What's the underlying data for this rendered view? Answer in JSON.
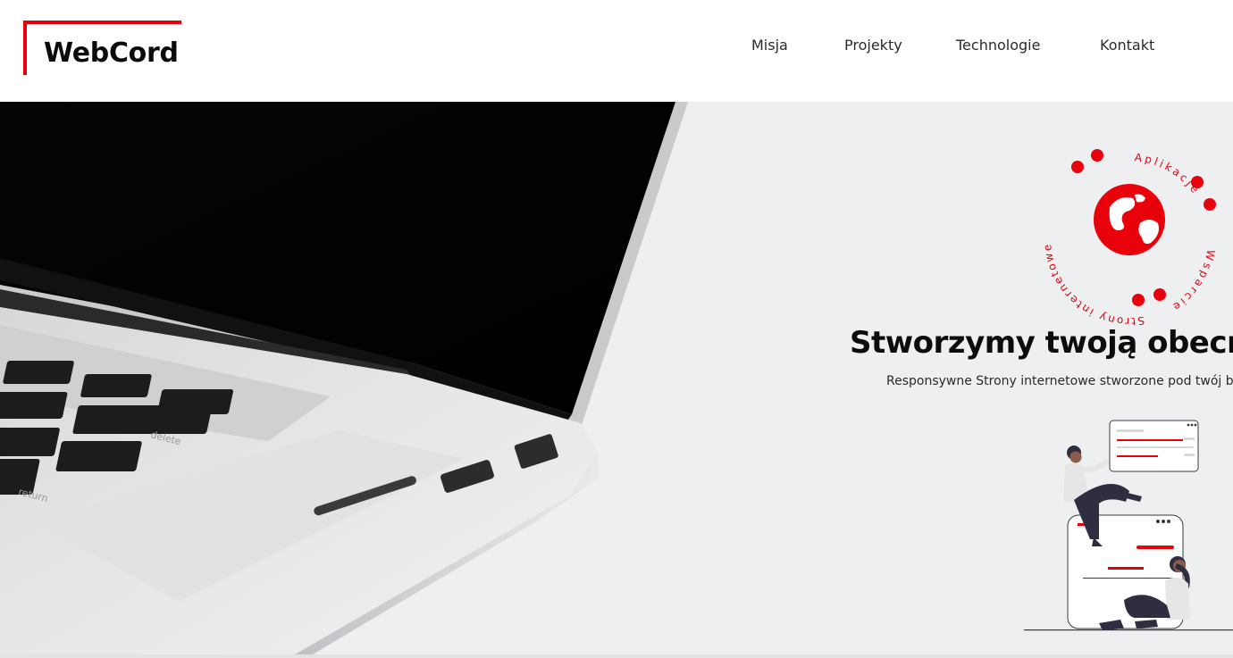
{
  "brand": {
    "name": "WebCord",
    "accent_color": "#e8000b"
  },
  "nav": {
    "items": [
      {
        "label": "Misja"
      },
      {
        "label": "Projekty"
      },
      {
        "label": "Technologie"
      },
      {
        "label": "Kontakt"
      }
    ]
  },
  "hero": {
    "title": "Stworzymy twoją obecn",
    "subtitle": "Responsywne Strony internetowe stworzone pod twój b",
    "badge": {
      "icon": "globe-icon",
      "ring_words": [
        "Aplikacje",
        "Wsparcie",
        "Strony internetowe"
      ]
    },
    "illustration_icon": "people-website-illustration",
    "image_icon": "laptop-photo"
  }
}
